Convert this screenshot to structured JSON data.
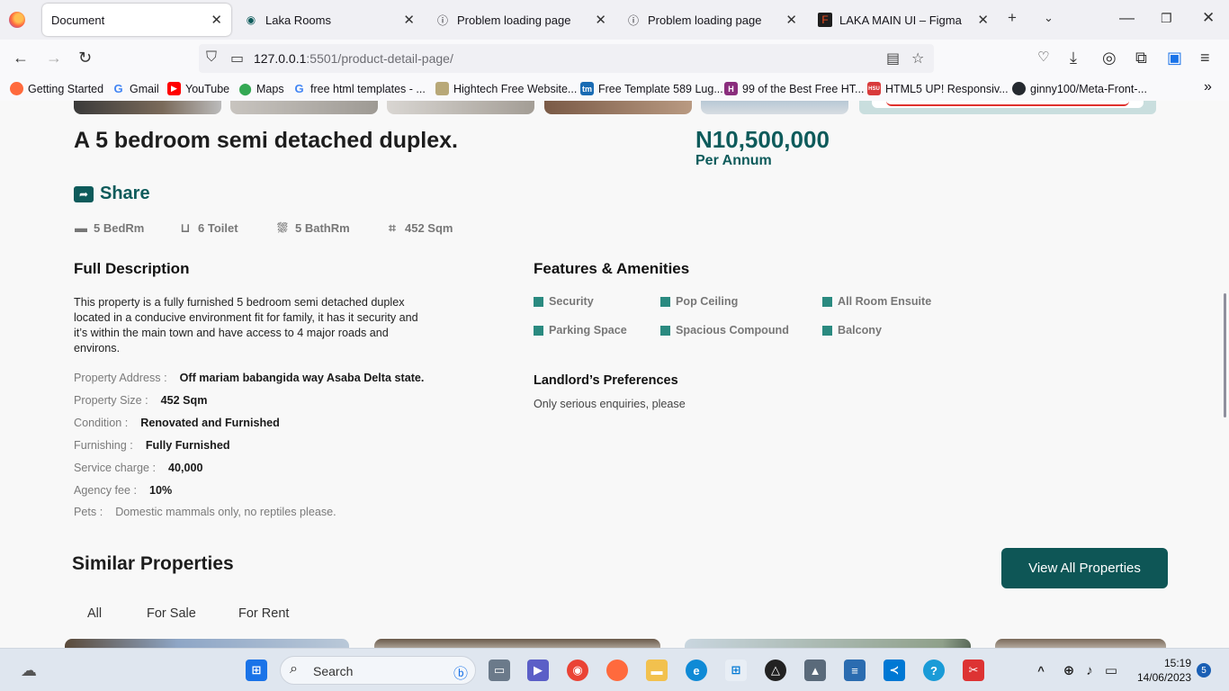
{
  "browser": {
    "tabs": [
      {
        "title": "Document",
        "active": true,
        "icon": "page-icon"
      },
      {
        "title": "Laka Rooms",
        "active": false,
        "icon": "laka-icon"
      },
      {
        "title": "Problem loading page",
        "active": false,
        "icon": "info-icon"
      },
      {
        "title": "Problem loading page",
        "active": false,
        "icon": "info-icon"
      },
      {
        "title": "LAKA MAIN UI – Figma",
        "active": false,
        "icon": "figma-icon"
      }
    ],
    "url_host": "127.0.0.1",
    "url_rest": ":5501/product-detail-page/",
    "bookmarks": [
      {
        "label": "Getting Started",
        "icon": "firefox-icon",
        "color": "#ff6a3d"
      },
      {
        "label": "Gmail",
        "icon": "google-icon",
        "color": "#4285f4"
      },
      {
        "label": "YouTube",
        "icon": "youtube-icon",
        "color": "#ff0000"
      },
      {
        "label": "Maps",
        "icon": "maps-icon",
        "color": "#34a853"
      },
      {
        "label": "free html templates - ...",
        "icon": "google-icon",
        "color": "#4285f4"
      },
      {
        "label": "Hightech Free Website...",
        "icon": "site-icon",
        "color": "#b8a878"
      },
      {
        "label": "Free Template 589 Lug...",
        "icon": "tm-icon",
        "color": "#1a6bb3"
      },
      {
        "label": "99 of the Best Free HT...",
        "icon": "h-icon",
        "color": "#8a2d7d"
      },
      {
        "label": "HTML5 UP! Responsiv...",
        "icon": "hsu-icon",
        "color": "#d83a3a"
      },
      {
        "label": "ginny100/Meta-Front-...",
        "icon": "github-icon",
        "color": "#24292f"
      }
    ]
  },
  "page": {
    "title": "A 5 bedroom semi detached duplex.",
    "price": "N10,500,000",
    "price_period": "Per Annum",
    "share_label": "Share",
    "specs": [
      {
        "label": "5 BedRm",
        "icon": "bed-icon"
      },
      {
        "label": "6 Toilet",
        "icon": "toilet-icon"
      },
      {
        "label": "5 BathRm",
        "icon": "shower-icon"
      },
      {
        "label": "452 Sqm",
        "icon": "area-icon"
      }
    ],
    "description_heading": "Full Description",
    "description": "This property is a fully furnished 5 bedroom semi detached duplex located in a conducive environment fit for family, it has it security and it’s within the main town and have access to 4 major roads and environs.",
    "details": [
      {
        "key": "Property Address :",
        "value": "Off mariam babangida way Asaba Delta state."
      },
      {
        "key": "Property Size :",
        "value": "452 Sqm"
      },
      {
        "key": "Condition :",
        "value": "Renovated and Furnished"
      },
      {
        "key": "Furnishing :",
        "value": "Fully Furnished"
      },
      {
        "key": "Service charge :",
        "value": "40,000"
      },
      {
        "key": "Agency fee :",
        "value": "10%"
      },
      {
        "key": "Pets :",
        "value": "Domestic mammals only, no reptiles please."
      }
    ],
    "features_heading": "Features & Amenities",
    "features": [
      "Security",
      "Pop Ceiling",
      "All Room Ensuite",
      "Parking Space",
      "Spacious Compound",
      "Balcony"
    ],
    "preferences_heading": "Landlord’s Preferences",
    "preferences_text": "Only serious enquiries, please",
    "similar_heading": "Similar Properties",
    "view_all_label": "View All Properties",
    "filter_tabs": [
      "All",
      "For Sale",
      "For Rent"
    ],
    "accent_color": "#0e5b5b"
  },
  "taskbar": {
    "search_placeholder": "Search",
    "time": "15:19",
    "date": "14/06/2023",
    "notification_count": "5"
  }
}
